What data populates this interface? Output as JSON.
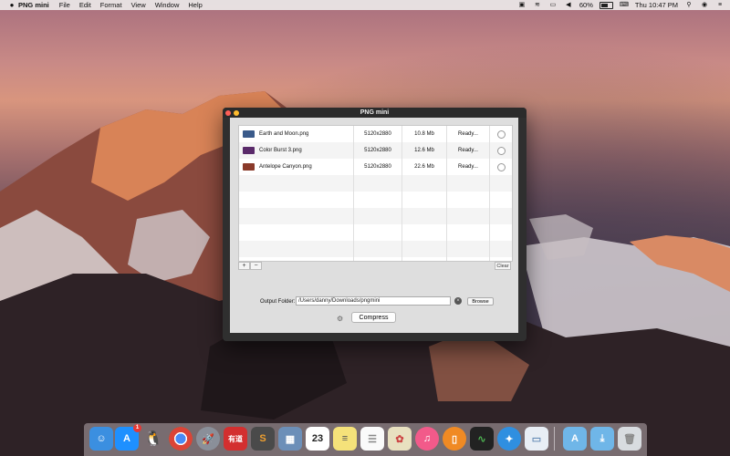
{
  "menubar": {
    "app_name": "PNG mini",
    "menus": [
      "File",
      "Edit",
      "Format",
      "View",
      "Window",
      "Help"
    ],
    "battery": "60%",
    "clock": "Thu 10:47 PM"
  },
  "window": {
    "title": "PNG mini",
    "files": [
      {
        "name": "Earth and Moon.png",
        "dimensions": "5120x2880",
        "size": "10.8 Mb",
        "status": "Ready...",
        "thumb_color": "#3a5a8a"
      },
      {
        "name": "Color Burst 3.png",
        "dimensions": "5120x2880",
        "size": "12.6 Mb",
        "status": "Ready...",
        "thumb_color": "#5a2a6a"
      },
      {
        "name": "Antelope Canyon.png",
        "dimensions": "5120x2880",
        "size": "22.6 Mb",
        "status": "Ready...",
        "thumb_color": "#8a3a2a"
      }
    ],
    "add_label": "+",
    "remove_label": "−",
    "clear_label": "Clear",
    "output_folder_label": "Output Folder:",
    "output_folder_path": "/Users/danny/Downloads/pngmini",
    "browse_label": "Browse",
    "compress_label": "Compress"
  },
  "dock": {
    "app_store_badge": "1",
    "calendar_day": "23",
    "youdao_label": "有道",
    "apps": [
      "finder",
      "app-store",
      "qq",
      "chrome",
      "launchpad",
      "youdao",
      "sublime",
      "preview",
      "calendar",
      "notes",
      "reminders",
      "photos",
      "itunes",
      "ibooks",
      "activity-monitor",
      "safari",
      "png-mini",
      "applications-folder",
      "documents-folder",
      "trash"
    ]
  }
}
